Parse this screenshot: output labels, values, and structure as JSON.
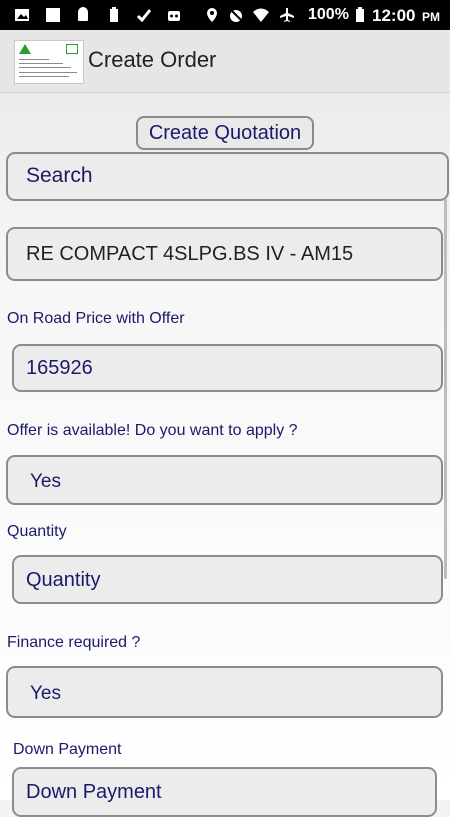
{
  "status_bar": {
    "battery": "100%",
    "time": "12:00",
    "am_pm": "PM",
    "icons": [
      "image-icon",
      "square-icon",
      "android-icon",
      "battery-small-icon",
      "check-flag-icon",
      "robot-icon",
      "location-icon",
      "alarm-icon",
      "wifi-icon",
      "airplane-icon",
      "battery-icon"
    ]
  },
  "app_bar": {
    "title": "Create Order",
    "logo_icon": "company-logo-icon"
  },
  "form": {
    "create_quotation_label": "Create Quotation",
    "search_placeholder": "Search",
    "model_value": "RE COMPACT 4SLPG.BS IV - AM15",
    "on_road_price_label": "On Road Price with Offer",
    "on_road_price_value": "165926",
    "offer_label": "Offer is available! Do you want to apply ?",
    "offer_value": "Yes",
    "quantity_label": "Quantity",
    "quantity_placeholder": "Quantity",
    "finance_label": "Finance required ?",
    "finance_value": "Yes",
    "down_payment_label": "Down Payment",
    "down_payment_placeholder": "Down Payment"
  },
  "colors": {
    "text_primary": "#1a1a6b",
    "field_border": "#8c8c8c",
    "field_bg": "#ececec"
  }
}
